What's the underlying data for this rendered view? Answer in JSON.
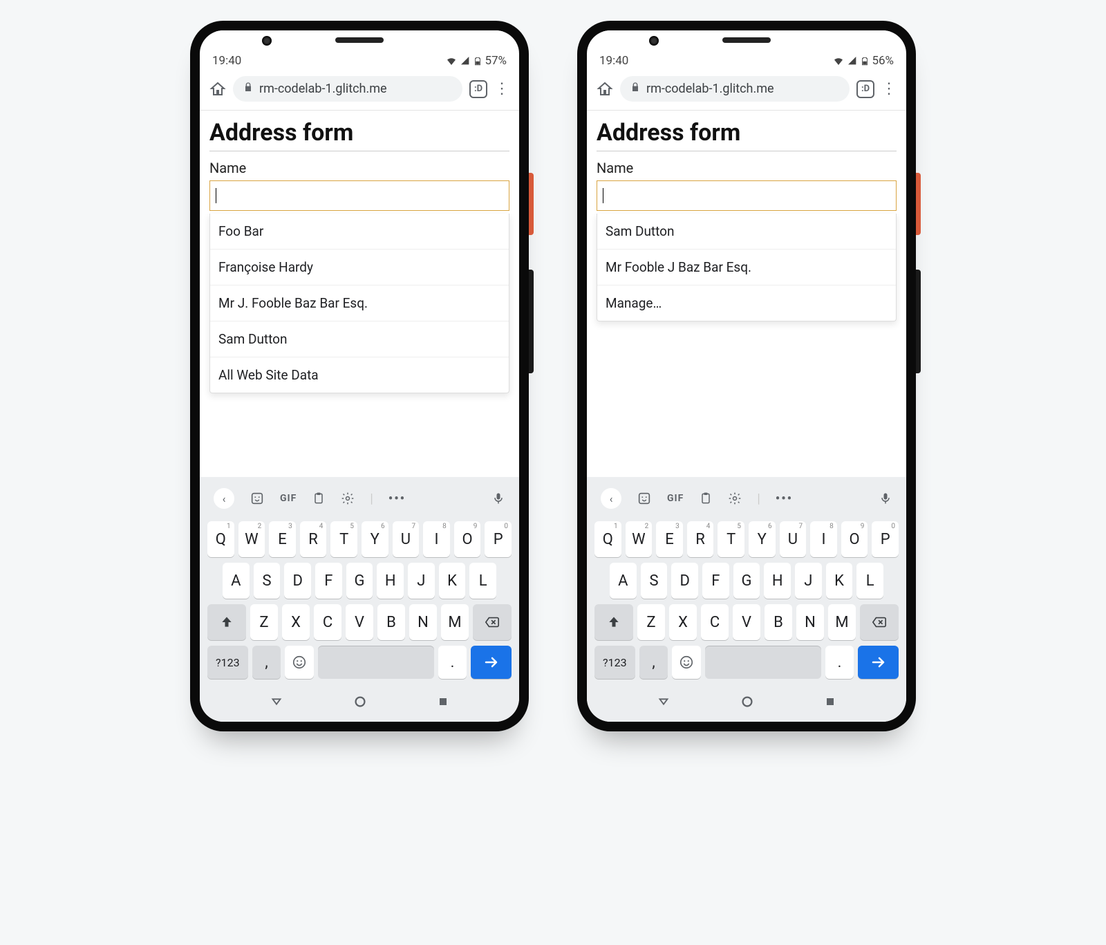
{
  "phones": [
    {
      "status": {
        "time": "19:40",
        "battery": "57%"
      },
      "browser": {
        "url": "rm-codelab-1.glitch.me",
        "tab_badge": ":D"
      },
      "page": {
        "title": "Address form",
        "name_label": "Name",
        "name_value": ""
      },
      "suggestions": [
        "Foo Bar",
        "Françoise Hardy",
        "Mr J. Fooble Baz Bar Esq.",
        "Sam Dutton",
        "All Web Site Data"
      ]
    },
    {
      "status": {
        "time": "19:40",
        "battery": "56%"
      },
      "browser": {
        "url": "rm-codelab-1.glitch.me",
        "tab_badge": ":D"
      },
      "page": {
        "title": "Address form",
        "name_label": "Name",
        "name_value": ""
      },
      "suggestions": [
        "Sam Dutton",
        "Mr Fooble J Baz Bar Esq.",
        "Manage…"
      ]
    }
  ],
  "keyboard": {
    "toolbar": {
      "gif": "GIF"
    },
    "row1": [
      {
        "k": "Q",
        "s": "1"
      },
      {
        "k": "W",
        "s": "2"
      },
      {
        "k": "E",
        "s": "3"
      },
      {
        "k": "R",
        "s": "4"
      },
      {
        "k": "T",
        "s": "5"
      },
      {
        "k": "Y",
        "s": "6"
      },
      {
        "k": "U",
        "s": "7"
      },
      {
        "k": "I",
        "s": "8"
      },
      {
        "k": "O",
        "s": "9"
      },
      {
        "k": "P",
        "s": "0"
      }
    ],
    "row2": [
      "A",
      "S",
      "D",
      "F",
      "G",
      "H",
      "J",
      "K",
      "L"
    ],
    "row3": [
      "Z",
      "X",
      "C",
      "V",
      "B",
      "N",
      "M"
    ],
    "row4": {
      "symbols": "?123",
      "comma": ",",
      "period": "."
    }
  }
}
